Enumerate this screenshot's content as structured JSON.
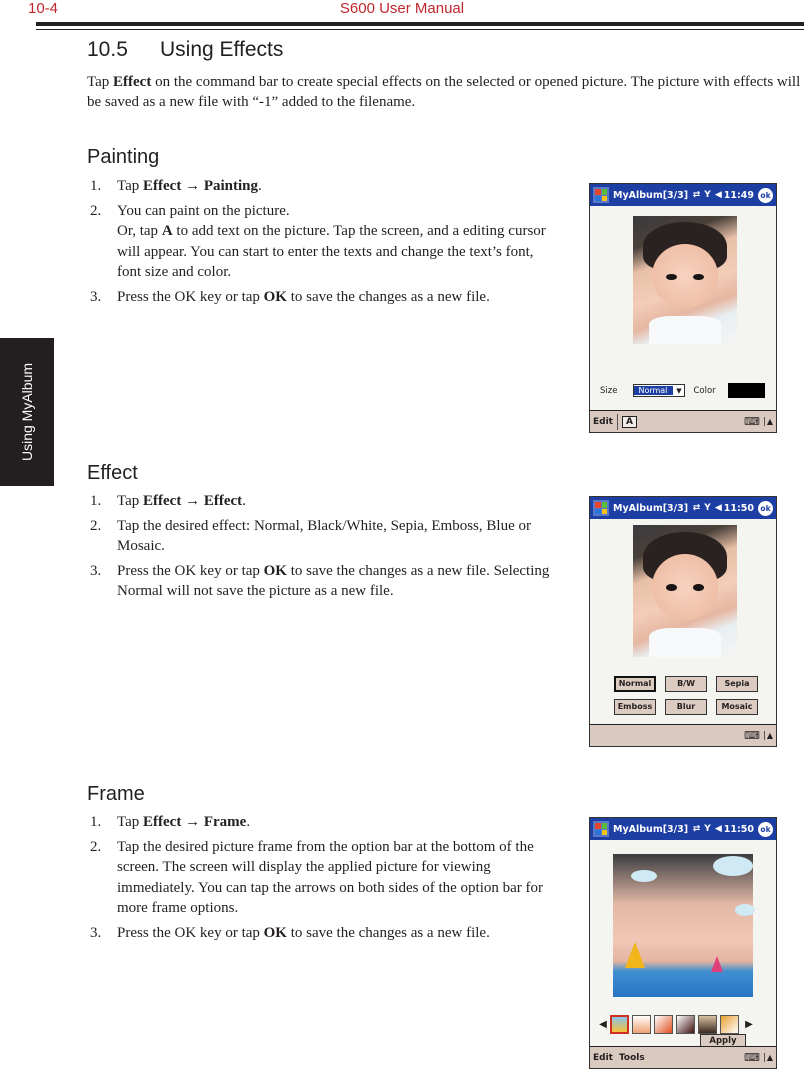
{
  "header": {
    "page_number": "10-4",
    "manual_title": "S600 User Manual"
  },
  "side_tab": "Using MyAlbum",
  "section": {
    "number": "10.5",
    "title": "Using Effects",
    "intro_prefix": "Tap ",
    "intro_bold": "Effect",
    "intro_suffix": " on the command bar to create special effects on the selected or opened picture. The picture with effects will be saved as a new file with “-1” added to the filename."
  },
  "painting": {
    "heading": "Painting",
    "steps": [
      {
        "num": "1.",
        "pre": "Tap ",
        "bold1": "Effect → Painting",
        "post": "."
      },
      {
        "num": "2.",
        "line1": "You can paint on the picture.",
        "pre": "Or, tap ",
        "bold1": "A",
        "post": " to add text on the picture. Tap the screen, and a editing cursor will appear. You can start to enter the texts and change the text’s font, font size and color."
      },
      {
        "num": "3.",
        "pre": "Press the OK key or tap ",
        "bold1": "OK",
        "post": " to save the changes as a new file."
      }
    ],
    "screen": {
      "title": "MyAlbum[3/3]",
      "time": "11:49",
      "ok": "ok",
      "size_label": "Size",
      "size_value": "Normal",
      "color_label": "Color",
      "color_value": "#000000",
      "cmd_edit": "Edit",
      "cmd_a": "A"
    }
  },
  "effect": {
    "heading": "Effect",
    "steps": [
      {
        "num": "1.",
        "pre": "Tap ",
        "bold1": "Effect → Effect",
        "post": "."
      },
      {
        "num": "2.",
        "pre": "Tap the desired effect: Normal, Black/White, Sepia, Emboss, Blue or Mosaic.",
        "bold1": "",
        "post": ""
      },
      {
        "num": "3.",
        "pre": "Press the OK key or tap ",
        "bold1": "OK",
        "post": " to save the changes as a new file. Selecting Normal will not save the picture as a new file."
      }
    ],
    "screen": {
      "title": "MyAlbum[3/3]",
      "time": "11:50",
      "ok": "ok",
      "buttons": [
        "Normal",
        "B/W",
        "Sepia",
        "Emboss",
        "Blur",
        "Mosaic"
      ]
    }
  },
  "frame": {
    "heading": "Frame",
    "steps": [
      {
        "num": "1.",
        "pre": "Tap ",
        "bold1": "Effect → Frame",
        "post": "."
      },
      {
        "num": "2.",
        "pre": "Tap the desired picture frame from the option bar at the bottom of the screen. The screen will display the applied picture for viewing immediately. You can tap the arrows on both sides of the option bar for more frame options.",
        "bold1": "",
        "post": ""
      },
      {
        "num": "3.",
        "pre": "Press the OK key or tap ",
        "bold1": "OK",
        "post": " to save the changes as a new file."
      }
    ],
    "screen": {
      "title": "MyAlbum[3/3]",
      "time": "11:50",
      "ok": "ok",
      "apply": "Apply",
      "cmd_edit": "Edit",
      "cmd_tools": "Tools",
      "left_arrow": "◀",
      "right_arrow": "▶"
    }
  }
}
